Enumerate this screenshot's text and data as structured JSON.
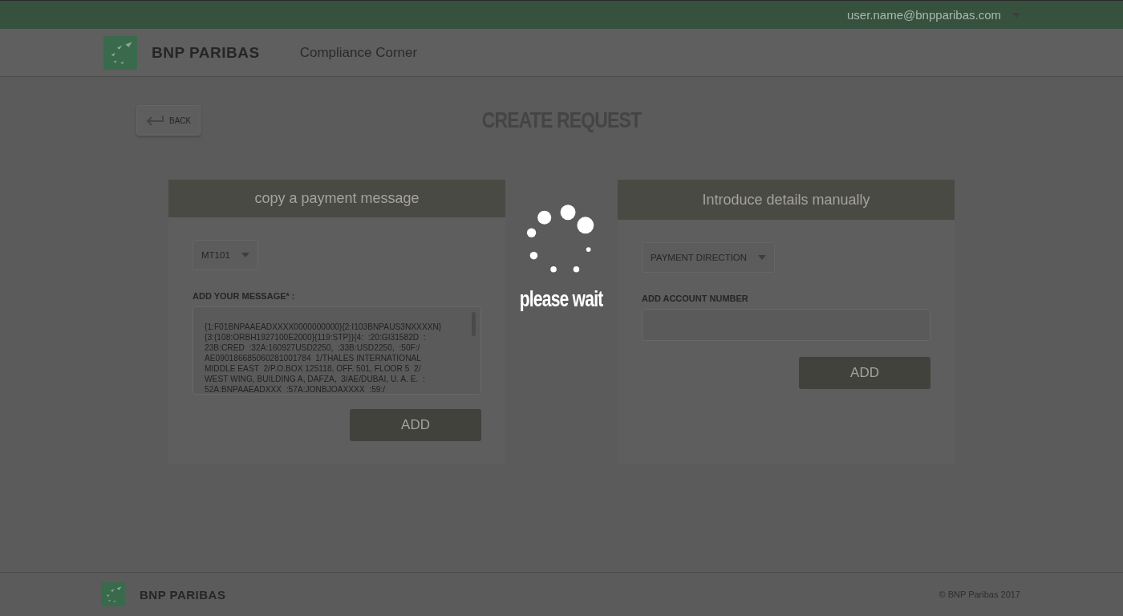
{
  "top_bar": {
    "user": "user.name@bnpparibas.com"
  },
  "header": {
    "brand": "BNP PARIBAS",
    "app_title": "Compliance Corner"
  },
  "back_button": {
    "label": "BACK"
  },
  "page_title": "CREATE REQUEST",
  "left_panel": {
    "title": "copy a payment message",
    "select": "MT101",
    "message_label": "ADD YOUR MESSAGE* :",
    "message": "{1:F01BNPAAEADXXXX0000000000}{2:I103BNPAUS3NXXXXN}\n{3:{108:ORBH1927100E2000}{119:STP}}{4:  :20:GI31582D  :\n23B:CRED  :32A:160927USD2250,  :33B:USD2250,  :50F:/\nAE090186685060281001784  1/THALES INTERNATIONAL\nMIDDLE EAST  2/P.O.BOX 125118, OFF. 501, FLOOR 5  2/\nWEST WING, BUILDING A, DAFZA,  3/AE/DUBAI, U. A. E.  :\n52A:BNPAAEADXXX  :57A:JONBJOAXXXX  :59:/",
    "button": "ADD"
  },
  "loading": {
    "text": "please wait"
  },
  "right_panel": {
    "title": "Introduce details manually",
    "select": "PAYMENT DIRECTION",
    "account_label": "ADD ACCOUNT NUMBER",
    "button": "ADD"
  },
  "footer": {
    "brand": "BNP PARIBAS",
    "copyright": "© BNP Paribas 2017"
  }
}
